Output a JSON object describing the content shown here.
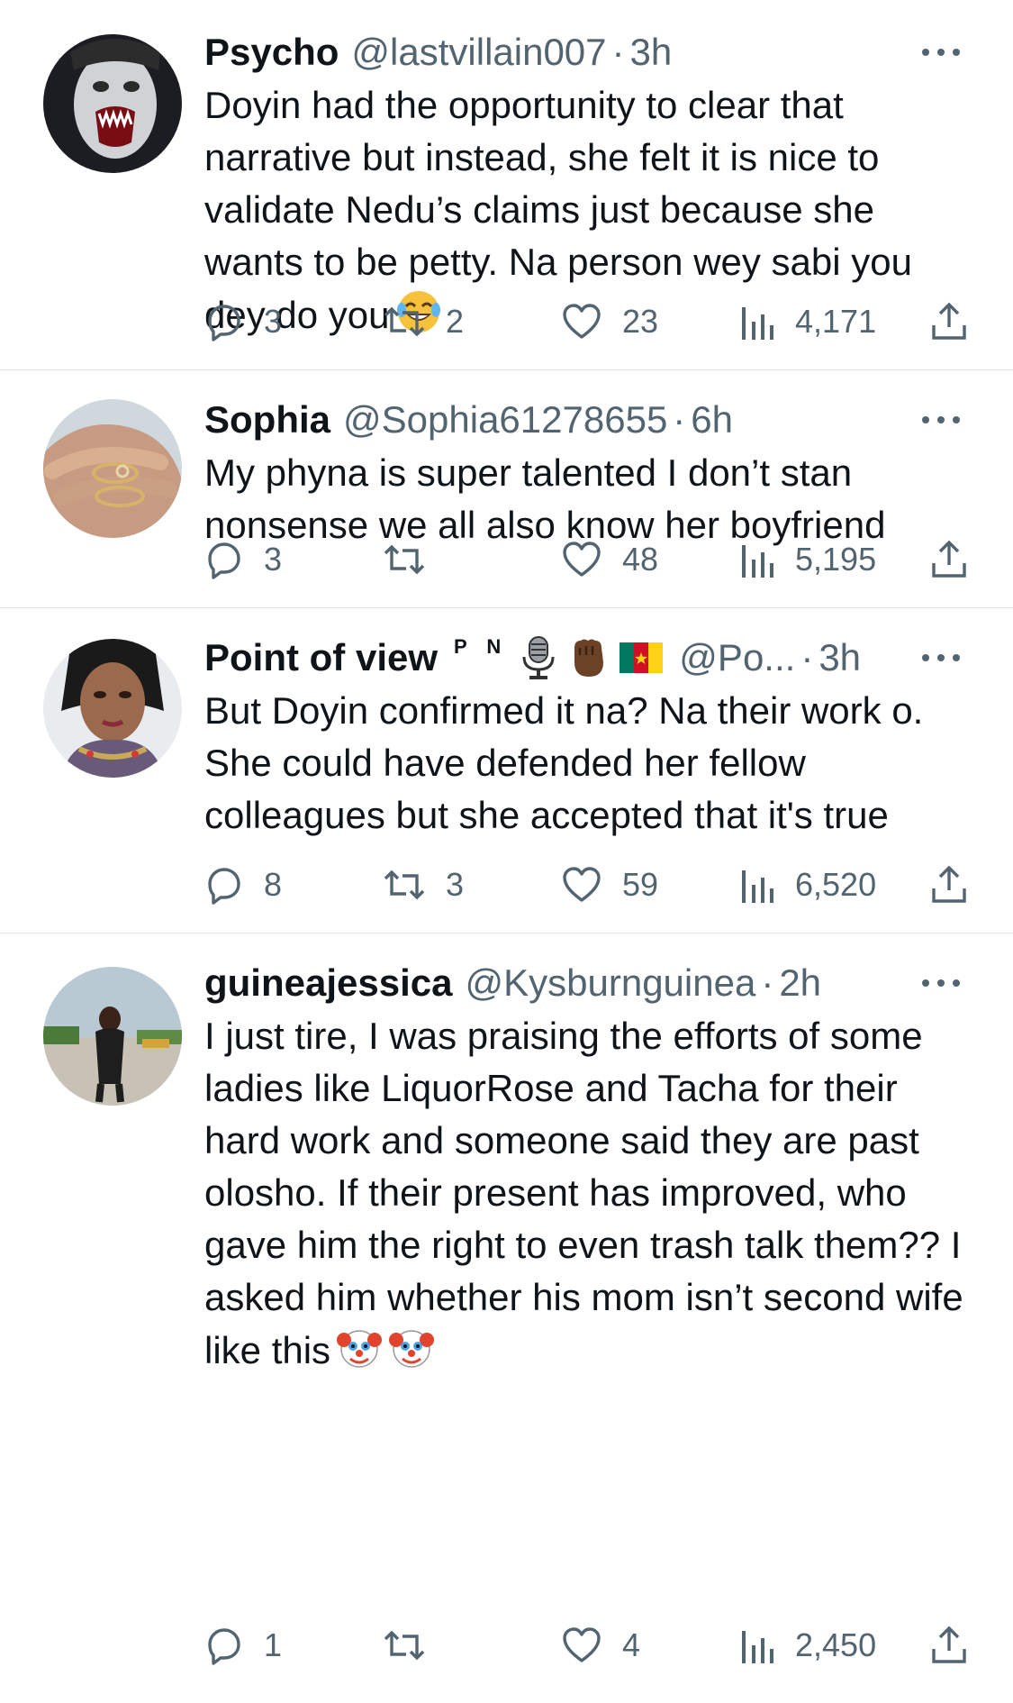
{
  "tweets": [
    {
      "name": "Psycho",
      "handle": "@lastvillain007",
      "time": "3h",
      "text": "Doyin had the opportunity to clear that narrative but instead, she felt it is nice to validate Nedu’s claims just because she wants to be petty. Na person wey sabi you dey do you",
      "replies": "3",
      "retweets": "2",
      "likes": "23",
      "views": "4,171"
    },
    {
      "name": "Sophia",
      "handle": "@Sophia61278655",
      "time": "6h",
      "text": "My phyna is super talented I don’t stan nonsense we all also know her boyfriend",
      "replies": "3",
      "retweets": "",
      "likes": "48",
      "views": "5,195"
    },
    {
      "name": "Point of view",
      "badge": "P N",
      "handle": "@Po...",
      "time": "3h",
      "text": "But Doyin confirmed it na? Na their work o. She could have defended her fellow colleagues but she accepted that it's true",
      "replies": "8",
      "retweets": "3",
      "likes": "59",
      "views": "6,520"
    },
    {
      "name": "guineajessica",
      "handle": "@Kysburnguinea",
      "time": "2h",
      "text": "I just tire, I was praising the efforts of some ladies like LiquorRose and Tacha for their hard work and someone said they are past olosho. If their present has improved, who gave him the right to even trash talk them?? I asked him whether his mom isn’t second wife like this",
      "replies": "1",
      "retweets": "",
      "likes": "4",
      "views": "2,450"
    }
  ],
  "icons": {
    "reply": "reply-icon",
    "retweet": "retweet-icon",
    "like": "heart-icon",
    "views": "views-icon",
    "share": "share-icon",
    "more": "more-icon"
  },
  "colors": {
    "text": "#0f1419",
    "secondary": "#536471",
    "divider": "#e3e6e9"
  }
}
